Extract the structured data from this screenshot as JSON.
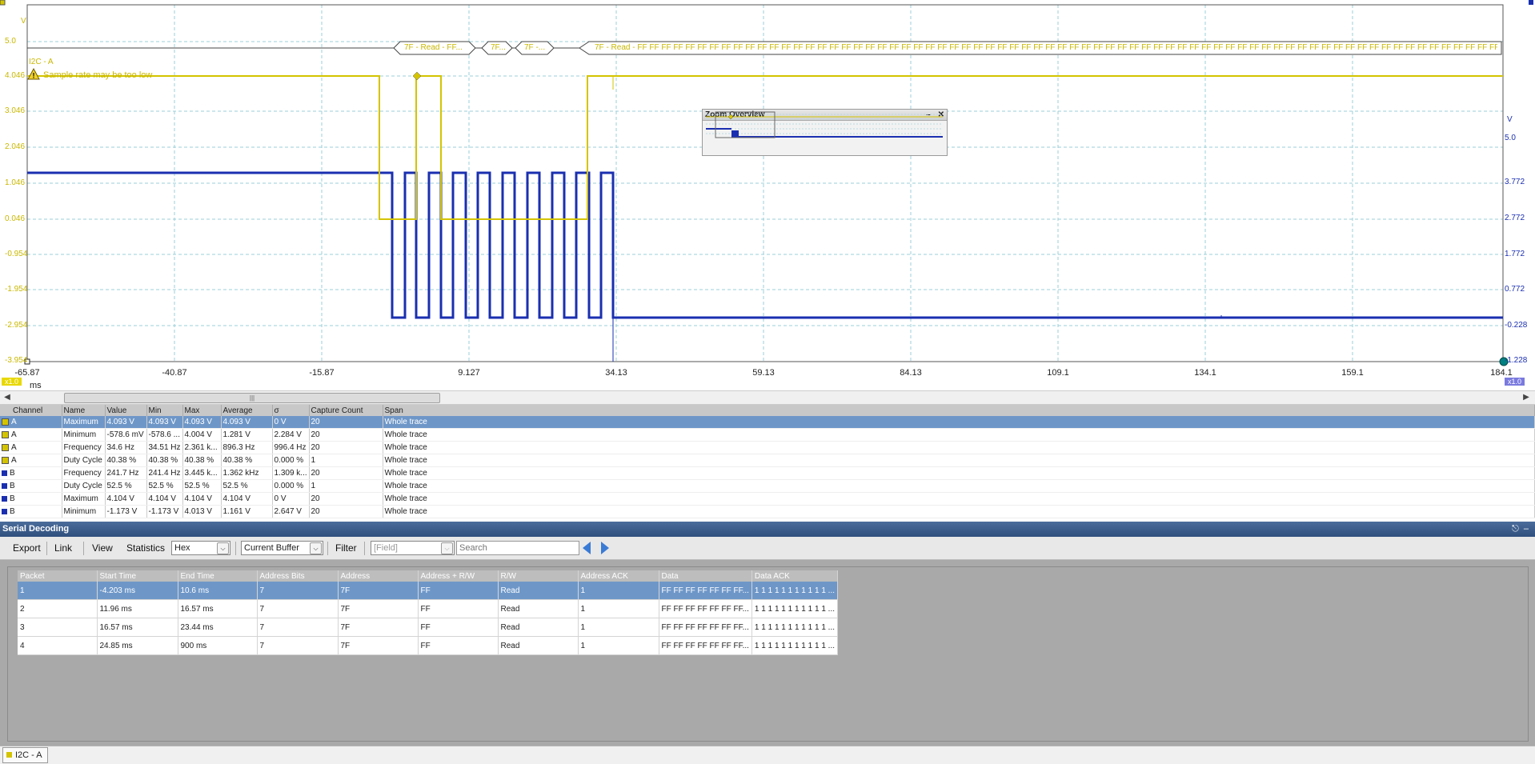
{
  "scope": {
    "y_left_unit": "V",
    "y_right_unit": "V",
    "x_unit": "ms",
    "left_ticks": [
      "5.0",
      "4.046",
      "3.046",
      "2.046",
      "1.046",
      "0.046",
      "-0.954",
      "-1.954",
      "-2.954",
      "-3.954"
    ],
    "right_ticks": [
      "5.0",
      "3.772",
      "2.772",
      "1.772",
      "0.772",
      "-0.228",
      "-1.228"
    ],
    "x_ticks": [
      "-65.87",
      "-40.87",
      "-15.87",
      "9.127",
      "34.13",
      "59.13",
      "84.13",
      "109.1",
      "134.1",
      "159.1",
      "184.1"
    ],
    "decode_channel_label": "I2C - A",
    "warning_text": "Sample rate may be too low",
    "packet_labels": [
      "7F - Read - FF...",
      "7F...",
      "7F -...",
      "7F - Read - FF FF FF FF FF FF FF FF FF FF FF FF FF FF FF FF FF FF FF FF FF FF FF FF FF FF FF FF FF FF FF FF FF FF FF FF FF FF FF FF FF FF FF FF FF FF FF FF FF FF FF FF FF FF FF FF FF FF FF FF FF FF FF FF FF FF FF FF FF FF FF FF FF FF FF FF FF FF FF FF FF FF FF FF FF FF FF FF FF FF FF FF FF FF FF FF FF FF FF FF FF FF FF FF FF FF"
    ],
    "left_zoom_badge": "x1.0",
    "right_zoom_badge": "x1.0",
    "zoom_overview_title": "Zoom Overview",
    "colors": {
      "channel_a": "#d4c400",
      "channel_b": "#1a2fb0",
      "grid": "#9bcfd9"
    }
  },
  "measurements": {
    "columns": [
      "Channel",
      "Name",
      "Value",
      "Min",
      "Max",
      "Average",
      "σ",
      "Capture Count",
      "Span"
    ],
    "rows": [
      [
        "A",
        "Maximum",
        "4.093 V",
        "4.093 V",
        "4.093 V",
        "4.093 V",
        "0 V",
        "20",
        "Whole trace"
      ],
      [
        "A",
        "Minimum",
        "-578.6 mV",
        "-578.6 ...",
        "4.004 V",
        "1.281 V",
        "2.284 V",
        "20",
        "Whole trace"
      ],
      [
        "A",
        "Frequency",
        "34.6 Hz",
        "34.51 Hz",
        "2.361 k...",
        "896.3 Hz",
        "996.4 Hz",
        "20",
        "Whole trace"
      ],
      [
        "A",
        "Duty Cycle",
        "40.38 %",
        "40.38 %",
        "40.38 %",
        "40.38 %",
        "0.000 %",
        "1",
        "Whole trace"
      ],
      [
        "B",
        "Frequency",
        "241.7 Hz",
        "241.4 Hz",
        "3.445 k...",
        "1.362 kHz",
        "1.309 k...",
        "20",
        "Whole trace"
      ],
      [
        "B",
        "Duty Cycle",
        "52.5 %",
        "52.5 %",
        "52.5 %",
        "52.5 %",
        "0.000 %",
        "1",
        "Whole trace"
      ],
      [
        "B",
        "Maximum",
        "4.104 V",
        "4.104 V",
        "4.104 V",
        "4.104 V",
        "0 V",
        "20",
        "Whole trace"
      ],
      [
        "B",
        "Minimum",
        "-1.173 V",
        "-1.173 V",
        "4.013 V",
        "1.161 V",
        "2.647 V",
        "20",
        "Whole trace"
      ]
    ]
  },
  "serial": {
    "title": "Serial Decoding",
    "toolbar": {
      "export": "Export",
      "link": "Link",
      "view": "View",
      "statistics": "Statistics",
      "format_value": "Hex",
      "buffer_value": "Current Buffer",
      "filter": "Filter",
      "field_placeholder": "[Field]",
      "search_placeholder": "Search"
    },
    "columns": [
      "Packet",
      "Start Time",
      "End Time",
      "Address Bits",
      "Address",
      "Address + R/W",
      "R/W",
      "Address ACK",
      "Data",
      "Data ACK"
    ],
    "rows": [
      [
        "1",
        "-4.203 ms",
        "10.6 ms",
        "7",
        "7F",
        "FF",
        "Read",
        "1",
        "FF FF FF FF FF FF FF...",
        "1 1 1 1 1 1 1 1 1 1 1 ..."
      ],
      [
        "2",
        "11.96 ms",
        "16.57 ms",
        "7",
        "7F",
        "FF",
        "Read",
        "1",
        "FF FF FF FF FF FF FF...",
        "1 1 1 1 1 1 1 1 1 1 1 ..."
      ],
      [
        "3",
        "16.57 ms",
        "23.44 ms",
        "7",
        "7F",
        "FF",
        "Read",
        "1",
        "FF FF FF FF FF FF FF...",
        "1 1 1 1 1 1 1 1 1 1 1 ..."
      ],
      [
        "4",
        "24.85 ms",
        "900 ms",
        "7",
        "7F",
        "FF",
        "Read",
        "1",
        "FF FF FF FF FF FF FF...",
        "1 1 1 1 1 1 1 1 1 1 1 ..."
      ]
    ]
  },
  "status": {
    "tab_label": "I2C - A"
  }
}
